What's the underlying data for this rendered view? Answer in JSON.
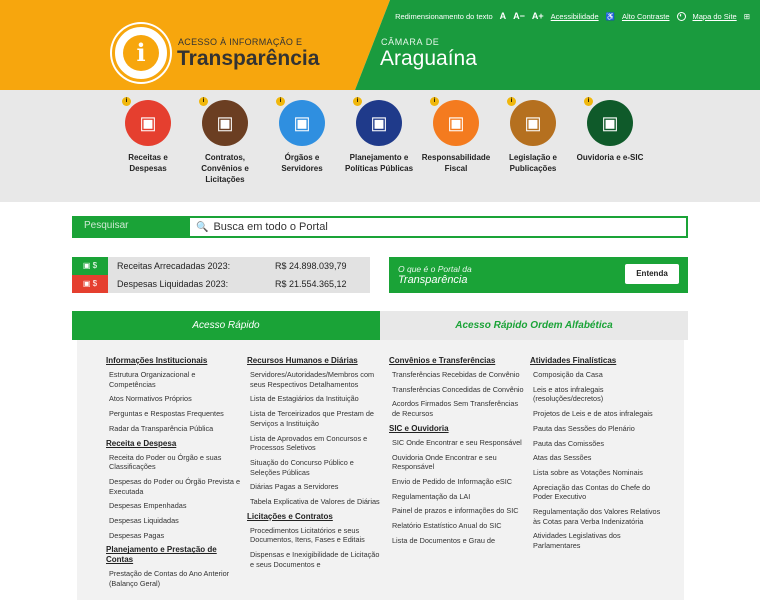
{
  "header": {
    "logo_small": "ACESSO À INFORMAÇÃO E",
    "logo_big": "Transparência",
    "logo_icon": "i",
    "chamber_small": "CÂMARA DE",
    "chamber_big": "Araguaína",
    "resize_label": "Redimensionamento do texto",
    "font_a": "A",
    "font_minus": "A−",
    "font_plus": "A+",
    "accessibility": "Acessibilidade",
    "contrast": "Alto Contraste",
    "sitemap": "Mapa do Site"
  },
  "categories": [
    {
      "label": "Receitas e Despesas",
      "color": "#e53f2f",
      "icon": "receipt-icon"
    },
    {
      "label": "Contratos, Convênios e Licitações",
      "color": "#6b3e22",
      "icon": "handshake-icon"
    },
    {
      "label": "Órgãos e Servidores",
      "color": "#2f8fe0",
      "icon": "people-icon"
    },
    {
      "label": "Planejamento e Políticas Públicas",
      "color": "#1f3a8a",
      "icon": "planning-icon"
    },
    {
      "label": "Responsabilidade Fiscal",
      "color": "#f47b1f",
      "icon": "lrf-icon"
    },
    {
      "label": "Legislação e Publicações",
      "color": "#b5701f",
      "icon": "scales-icon"
    },
    {
      "label": "Ouvidoria e e-SIC",
      "color": "#0f5a2a",
      "icon": "info-icon"
    }
  ],
  "info_badge": "i",
  "search": {
    "label": "Pesquisar",
    "placeholder": "Busca em todo o Portal"
  },
  "finance": [
    {
      "label": "Receitas Arrecadadas 2023:",
      "value": "R$ 24.898.039,79",
      "color": "#1aa337"
    },
    {
      "label": "Despesas Liquidadas 2023:",
      "value": "R$ 21.554.365,12",
      "color": "#e53f2f"
    }
  ],
  "promo": {
    "line1": "O que é o Portal da",
    "line2": "Transparência",
    "button": "Entenda"
  },
  "tabs": {
    "quick": "Acesso Rápido",
    "alpha": "Acesso Rápido Ordem Alfabética"
  },
  "columns": [
    [
      {
        "title": "Informações Institucionais",
        "items": [
          "Estrutura Organizacional e Competências",
          "Atos Normativos Próprios",
          "Perguntas e Respostas Frequentes",
          "Radar da Transparência Pública"
        ]
      },
      {
        "title": "Receita e Despesa",
        "items": [
          "Receita do Poder ou Órgão e suas Classificações",
          "Despesas do Poder ou Órgão Prevista e Executada",
          "Despesas Empenhadas",
          "Despesas Liquidadas",
          "Despesas Pagas"
        ]
      },
      {
        "title": "Planejamento e Prestação de Contas",
        "items": [
          "Prestação de Contas do Ano Anterior (Balanço Geral)"
        ]
      }
    ],
    [
      {
        "title": "Recursos Humanos e Diárias",
        "items": [
          "Servidores/Autoridades/Membros com seus Respectivos Detalhamentos",
          "Lista de Estagiários da Instituição",
          "Lista de Terceirizados que Prestam de Serviços a Instituição",
          "Lista de Aprovados em Concursos e Processos Seletivos",
          "Situação do Concurso Público e Seleções Públicas",
          "Diárias Pagas a Servidores",
          "Tabela Explicativa de Valores de Diárias"
        ]
      },
      {
        "title": "Licitações e Contratos",
        "items": [
          "Procedimentos Licitatórios e seus Documentos, Itens, Fases e Editais",
          "Dispensas e Inexigibilidade de Licitação e seus Documentos e"
        ]
      }
    ],
    [
      {
        "title": "Convênios e Transferências",
        "items": [
          "Transferências Recebidas de Convênio",
          "Transferências Concedidas de Convênio",
          "Acordos Firmados Sem Transferências de Recursos"
        ]
      },
      {
        "title": "SIC e Ouvidoria",
        "items": [
          "SIC Onde Encontrar e seu Responsável",
          "Ouvidoria Onde Encontrar e seu Responsável",
          "Envio de Pedido de Informação eSIC",
          "Regulamentação da LAI",
          "Painel de prazos e informações do SIC",
          "Relatório Estatístico Anual do SIC",
          "Lista de Documentos e Grau de"
        ]
      }
    ],
    [
      {
        "title": "Atividades Finalísticas",
        "items": [
          "Composição da Casa",
          "Leis e atos infralegais (resoluções/decretos)",
          "Projetos de Leis e de atos infralegais",
          "Pauta das Sessões do Plenário",
          "Pauta das Comissões",
          "Atas das Sessões",
          "Lista sobre as Votações Nominais",
          "Apreciação das Contas do Chefe do Poder Executivo",
          "Regulamentação dos Valores Relativos às Cotas para Verba Indenizatória",
          "Atividades Legislativas dos Parlamentares"
        ]
      }
    ]
  ]
}
